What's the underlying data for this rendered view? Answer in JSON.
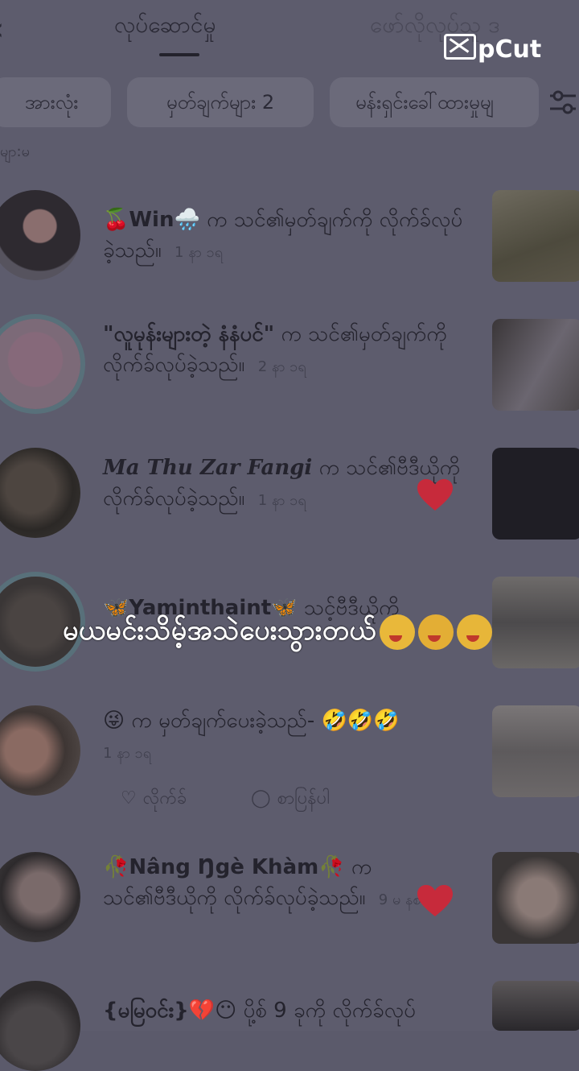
{
  "tabs": {
    "back_icon": "chevron-left",
    "active_label": "လုပ်ဆောင်မှု",
    "inactive_label": "ဖော်လိုလုပ်သူ ဒ"
  },
  "watermark": {
    "text": "pCut"
  },
  "filters": {
    "chip_all": "အားလုံး",
    "chip_comments": "မှတ်ချက်များ 2",
    "chip_mentions": "မန်းရှင်းခေါ်ထားမှုမျ",
    "filter_icon": "sliders-icon"
  },
  "section_peek": "မျာ:မ",
  "notifications": [
    {
      "name": "🍒Win🌧️",
      "text": "က သင်၏မှတ်ချက်ကို လိုက်ခ်လုပ်ခဲ့သည်။",
      "time": "1 နာ ၁ရ"
    },
    {
      "name": "\"လူမုန်းများတဲ့ နံနံပင်\"",
      "text": "က သင်၏မှတ်ချက်ကို လိုက်ခ်လုပ်ခဲ့သည်။",
      "time": "2 နာ ၁ရ"
    },
    {
      "name": "Ma Thu Zar Fangi",
      "text": "က သင်၏ဗီဒီယိုကို လိုက်ခ်လုပ်ခဲ့သည်။",
      "time": "1 နာ ၁ရ"
    },
    {
      "name": "🦋Yaminthaint🦋",
      "text": "သင့်ဗီဒီယိုကို",
      "time": ""
    },
    {
      "name": "😜",
      "text": "က မှတ်ချက်ပေးခဲ့သည်- 🤣🤣🤣",
      "time": "1 နာ ၁ရ",
      "like_label": "လိုက်ခ်",
      "reply_label": "စာပြန်ပါ"
    },
    {
      "name": "🥀Nâng Ŋgè Khàm🥀",
      "text": "က သင်၏ဗီဒီယိုကို လိုက်ခ်လုပ်ခဲ့သည်။",
      "time": "9 မ နစ"
    },
    {
      "name": "{မမြဝင်း}💔😶",
      "text": "ပို့စ် 9 ခုကို လိုက်ခ်လုပ်",
      "time": ""
    }
  ],
  "caption": {
    "text": "မယမင်းသိမ့်အသဲပေးသွားတယ်"
  },
  "colors": {
    "overlay": "#5d5c6d",
    "heart": "#c72a3b",
    "text": "#24232d"
  }
}
